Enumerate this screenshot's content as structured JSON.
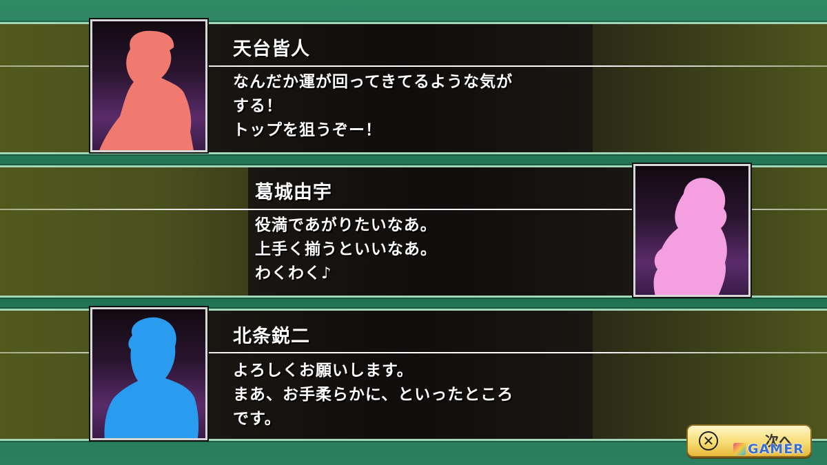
{
  "dialogues": [
    {
      "name": "天台皆人",
      "lines": [
        "なんだか運が回ってきてるような気が",
        "する！",
        "トップを狙うぞー！"
      ],
      "portrait_color": "#f07a70",
      "portrait_side": "left"
    },
    {
      "name": "葛城由宇",
      "lines": [
        "役満であがりたいなあ。",
        "上手く揃うといいなあ。",
        "わくわく♪"
      ],
      "portrait_color": "#f4a0e0",
      "portrait_side": "right"
    },
    {
      "name": "北条鋭二",
      "lines": [
        "よろしくお願いします。",
        "まあ、お手柔らかに、といったところ",
        "です。"
      ],
      "portrait_color": "#2a9cf0",
      "portrait_side": "left"
    }
  ],
  "next_button": {
    "icon": "cross-button-icon",
    "label": "次へ"
  },
  "watermark": {
    "text": "GAMER"
  },
  "colors": {
    "background": "#2a7f5f",
    "band_border": "#9fd9b8",
    "button": "#f7dc74"
  }
}
